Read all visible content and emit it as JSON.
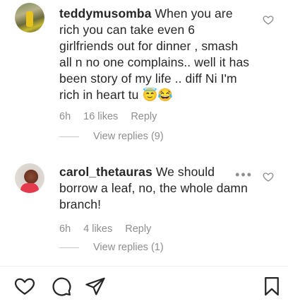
{
  "comments": [
    {
      "username": "teddymusomba",
      "text": "When you are rich you can take even 6 girlfriends out for dinner , smash all n no one complains.. well it has been story of my life .. diff Ni I'm rich in heart tu 😇😂",
      "time": "6h",
      "likes": "16 likes",
      "reply_label": "Reply",
      "view_replies": "View replies (9)"
    },
    {
      "username": "carol_thetauras",
      "text": "We should borrow a leaf, no, the whole damn branch!",
      "time": "6h",
      "likes": "4 likes",
      "reply_label": "Reply",
      "view_replies": "View replies (1)",
      "more_label": "•••"
    }
  ],
  "actions": {
    "like_icon": "heart-icon",
    "comment_icon": "comment-icon",
    "share_icon": "share-icon",
    "save_icon": "bookmark-icon"
  }
}
